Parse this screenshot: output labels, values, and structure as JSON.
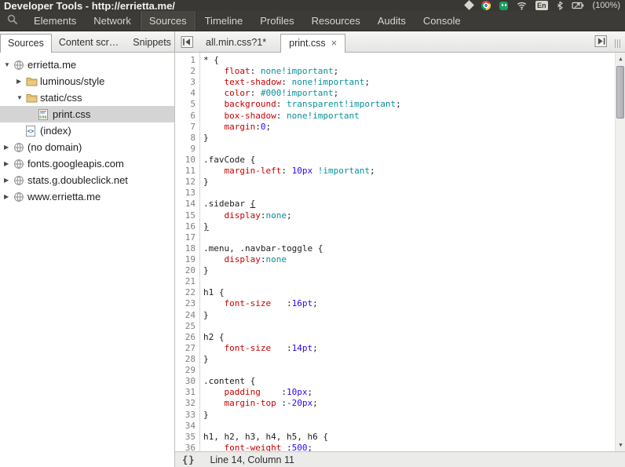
{
  "panel": {
    "title": "Developer Tools - http://errietta.me/",
    "keyboard": "En",
    "battery": "(100%)"
  },
  "menubar": {
    "tabs": [
      {
        "label": "Elements",
        "active": false
      },
      {
        "label": "Network",
        "active": false
      },
      {
        "label": "Sources",
        "active": true
      },
      {
        "label": "Timeline",
        "active": false
      },
      {
        "label": "Profiles",
        "active": false
      },
      {
        "label": "Resources",
        "active": false
      },
      {
        "label": "Audits",
        "active": false
      },
      {
        "label": "Console",
        "active": false
      }
    ]
  },
  "toolbar": {
    "panel_tabs": [
      {
        "label": "Sources",
        "active": true
      },
      {
        "label": "Content scr…",
        "active": false
      },
      {
        "label": "Snippets",
        "active": false
      }
    ],
    "file_tabs": [
      {
        "label": "all.min.css?1*",
        "active": false
      },
      {
        "label": "print.css",
        "active": true
      }
    ],
    "close_glyph": "×"
  },
  "sidebar": {
    "tree": [
      {
        "label": "errietta.me",
        "icon": "globe",
        "arrow": "▼",
        "level": 0,
        "selected": false
      },
      {
        "label": "luminous/style",
        "icon": "folder",
        "arrow": "▶",
        "level": 1,
        "selected": false
      },
      {
        "label": "static/css",
        "icon": "folder",
        "arrow": "▼",
        "level": 1,
        "selected": false
      },
      {
        "label": "print.css",
        "icon": "css-file",
        "arrow": "",
        "level": 2,
        "selected": true
      },
      {
        "label": "(index)",
        "icon": "code-file",
        "arrow": "",
        "level": 1,
        "selected": false
      },
      {
        "label": "(no domain)",
        "icon": "globe",
        "arrow": "▶",
        "level": 0,
        "selected": false
      },
      {
        "label": "fonts.googleapis.com",
        "icon": "globe",
        "arrow": "▶",
        "level": 0,
        "selected": false
      },
      {
        "label": "stats.g.doubleclick.net",
        "icon": "globe",
        "arrow": "▶",
        "level": 0,
        "selected": false
      },
      {
        "label": "www.errietta.me",
        "icon": "globe",
        "arrow": "▶",
        "level": 0,
        "selected": false
      }
    ]
  },
  "editor": {
    "lines": [
      {
        "n": 1,
        "s": [
          [
            "p",
            "* {"
          ]
        ]
      },
      {
        "n": 2,
        "s": [
          [
            "p",
            "    "
          ],
          [
            "k",
            "float"
          ],
          [
            "p",
            ": "
          ],
          [
            "a",
            "none!important"
          ],
          [
            "p",
            ";"
          ]
        ]
      },
      {
        "n": 3,
        "s": [
          [
            "p",
            "    "
          ],
          [
            "k",
            "text-shadow"
          ],
          [
            "p",
            ": "
          ],
          [
            "a",
            "none!important"
          ],
          [
            "p",
            ";"
          ]
        ]
      },
      {
        "n": 4,
        "s": [
          [
            "p",
            "    "
          ],
          [
            "k",
            "color"
          ],
          [
            "p",
            ": "
          ],
          [
            "a",
            "#000!important"
          ],
          [
            "p",
            ";"
          ]
        ]
      },
      {
        "n": 5,
        "s": [
          [
            "p",
            "    "
          ],
          [
            "k",
            "background"
          ],
          [
            "p",
            ": "
          ],
          [
            "a",
            "transparent!important"
          ],
          [
            "p",
            ";"
          ]
        ]
      },
      {
        "n": 6,
        "s": [
          [
            "p",
            "    "
          ],
          [
            "k",
            "box-shadow"
          ],
          [
            "p",
            ": "
          ],
          [
            "a",
            "none!important"
          ]
        ]
      },
      {
        "n": 7,
        "s": [
          [
            "p",
            "    "
          ],
          [
            "k",
            "margin"
          ],
          [
            "p",
            ":"
          ],
          [
            "n",
            "0"
          ],
          [
            "p",
            ";"
          ]
        ]
      },
      {
        "n": 8,
        "s": [
          [
            "p",
            "}"
          ]
        ]
      },
      {
        "n": 9,
        "s": []
      },
      {
        "n": 10,
        "s": [
          [
            "p",
            ".favCode {"
          ]
        ]
      },
      {
        "n": 11,
        "s": [
          [
            "p",
            "    "
          ],
          [
            "k",
            "margin-left"
          ],
          [
            "p",
            ": "
          ],
          [
            "n",
            "10px"
          ],
          [
            "p",
            " "
          ],
          [
            "a",
            "!important"
          ],
          [
            "p",
            ";"
          ]
        ]
      },
      {
        "n": 12,
        "s": [
          [
            "p",
            "}"
          ]
        ]
      },
      {
        "n": 13,
        "s": []
      },
      {
        "n": 14,
        "s": [
          [
            "p",
            ".sidebar "
          ],
          [
            "m",
            "{"
          ]
        ]
      },
      {
        "n": 15,
        "s": [
          [
            "p",
            "    "
          ],
          [
            "k",
            "display"
          ],
          [
            "p",
            ":"
          ],
          [
            "a",
            "none"
          ],
          [
            "p",
            ";"
          ]
        ]
      },
      {
        "n": 16,
        "s": [
          [
            "m",
            "}"
          ]
        ]
      },
      {
        "n": 17,
        "s": []
      },
      {
        "n": 18,
        "s": [
          [
            "p",
            ".menu, .navbar-toggle {"
          ]
        ]
      },
      {
        "n": 19,
        "s": [
          [
            "p",
            "    "
          ],
          [
            "k",
            "display"
          ],
          [
            "p",
            ":"
          ],
          [
            "a",
            "none"
          ]
        ]
      },
      {
        "n": 20,
        "s": [
          [
            "p",
            "}"
          ]
        ]
      },
      {
        "n": 21,
        "s": []
      },
      {
        "n": 22,
        "s": [
          [
            "p",
            "h1 {"
          ]
        ]
      },
      {
        "n": 23,
        "s": [
          [
            "p",
            "    "
          ],
          [
            "k",
            "font-size"
          ],
          [
            "p",
            "   :"
          ],
          [
            "n",
            "16pt"
          ],
          [
            "p",
            ";"
          ]
        ]
      },
      {
        "n": 24,
        "s": [
          [
            "p",
            "}"
          ]
        ]
      },
      {
        "n": 25,
        "s": []
      },
      {
        "n": 26,
        "s": [
          [
            "p",
            "h2 {"
          ]
        ]
      },
      {
        "n": 27,
        "s": [
          [
            "p",
            "    "
          ],
          [
            "k",
            "font-size"
          ],
          [
            "p",
            "   :"
          ],
          [
            "n",
            "14pt"
          ],
          [
            "p",
            ";"
          ]
        ]
      },
      {
        "n": 28,
        "s": [
          [
            "p",
            "}"
          ]
        ]
      },
      {
        "n": 29,
        "s": []
      },
      {
        "n": 30,
        "s": [
          [
            "p",
            ".content {"
          ]
        ]
      },
      {
        "n": 31,
        "s": [
          [
            "p",
            "    "
          ],
          [
            "k",
            "padding"
          ],
          [
            "p",
            "    :"
          ],
          [
            "n",
            "10px"
          ],
          [
            "p",
            ";"
          ]
        ]
      },
      {
        "n": 32,
        "s": [
          [
            "p",
            "    "
          ],
          [
            "k",
            "margin-top"
          ],
          [
            "p",
            " :"
          ],
          [
            "n",
            "-20px"
          ],
          [
            "p",
            ";"
          ]
        ]
      },
      {
        "n": 33,
        "s": [
          [
            "p",
            "}"
          ]
        ]
      },
      {
        "n": 34,
        "s": []
      },
      {
        "n": 35,
        "s": [
          [
            "p",
            "h1, h2, h3, h4, h5, h6 {"
          ]
        ]
      },
      {
        "n": 36,
        "s": [
          [
            "p",
            "    "
          ],
          [
            "k",
            "font-weight"
          ],
          [
            "p",
            " :"
          ],
          [
            "n",
            "500"
          ],
          [
            "p",
            ";"
          ]
        ]
      }
    ]
  },
  "statusbar": {
    "pretty_print": "{}",
    "position": "Line 14, Column 11"
  }
}
